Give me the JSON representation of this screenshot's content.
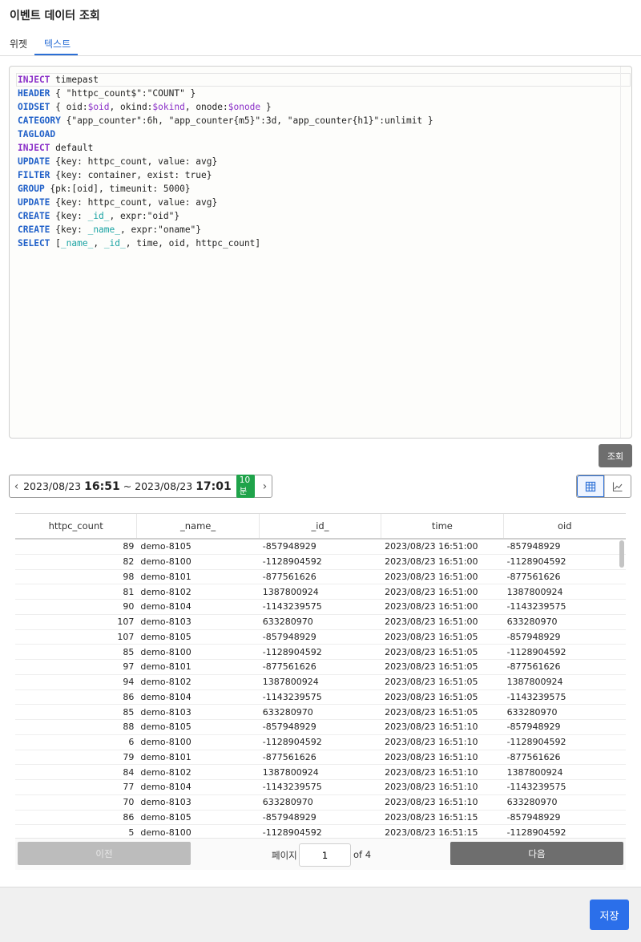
{
  "dialog": {
    "title": "이벤트 데이터 조회"
  },
  "tabs": [
    {
      "label": "위젯",
      "active": false
    },
    {
      "label": "텍스트",
      "active": true
    }
  ],
  "editor": {
    "lines": [
      [
        {
          "t": "INJECT",
          "c": "kw2"
        },
        {
          "t": " timepast"
        }
      ],
      [
        {
          "t": "HEADER",
          "c": "kw"
        },
        {
          "t": " { \"httpc_count$\":\"COUNT\" }"
        }
      ],
      [
        {
          "t": "OIDSET",
          "c": "kw"
        },
        {
          "t": " { oid:"
        },
        {
          "t": "$oid",
          "c": "var"
        },
        {
          "t": ", okind:"
        },
        {
          "t": "$okind",
          "c": "var"
        },
        {
          "t": ", onode:"
        },
        {
          "t": "$onode",
          "c": "var"
        },
        {
          "t": " }"
        }
      ],
      [
        {
          "t": "CATEGORY",
          "c": "kw"
        },
        {
          "t": " {\"app_counter\":6h, \"app_counter{m5}\":3d, \"app_counter{h1}\":unlimit }"
        }
      ],
      [
        {
          "t": "TAGLOAD",
          "c": "kw"
        }
      ],
      [
        {
          "t": "INJECT",
          "c": "kw2"
        },
        {
          "t": " default"
        }
      ],
      [
        {
          "t": "UPDATE",
          "c": "kw"
        },
        {
          "t": " {key: httpc_count, value: avg}"
        }
      ],
      [
        {
          "t": "FILTER",
          "c": "kw"
        },
        {
          "t": " {key: container, exist: true}"
        }
      ],
      [
        {
          "t": "GROUP",
          "c": "kw"
        },
        {
          "t": " {pk:[oid], timeunit: 5000}"
        }
      ],
      [
        {
          "t": "UPDATE",
          "c": "kw"
        },
        {
          "t": " {key: httpc_count, value: avg}"
        }
      ],
      [
        {
          "t": "CREATE",
          "c": "kw"
        },
        {
          "t": " {key: "
        },
        {
          "t": "_id_",
          "c": "cy"
        },
        {
          "t": ", expr:\"oid\"}"
        }
      ],
      [
        {
          "t": "CREATE",
          "c": "kw"
        },
        {
          "t": " {key: "
        },
        {
          "t": "_name_",
          "c": "cy"
        },
        {
          "t": ", expr:\"oname\"}"
        }
      ],
      [
        {
          "t": "SELECT",
          "c": "kw"
        },
        {
          "t": " ["
        },
        {
          "t": "_name_",
          "c": "cy"
        },
        {
          "t": ", "
        },
        {
          "t": "_id_",
          "c": "cy"
        },
        {
          "t": ", time, oid, httpc_count]"
        }
      ]
    ]
  },
  "query_button": "조회",
  "time_range": {
    "start_date": "2023/08/23",
    "start_time": "16:51",
    "separator": "~",
    "end_date": "2023/08/23",
    "end_time": "17:01",
    "duration": "10분"
  },
  "view_toggle": {
    "table_icon": "table-grid-icon",
    "chart_icon": "line-chart-icon",
    "active": "table"
  },
  "table": {
    "columns": [
      "httpc_count",
      "_name_",
      "_id_",
      "time",
      "oid"
    ],
    "rows": [
      [
        "89",
        "demo-8105",
        "-857948929",
        "2023/08/23 16:51:00",
        "-857948929"
      ],
      [
        "82",
        "demo-8100",
        "-1128904592",
        "2023/08/23 16:51:00",
        "-1128904592"
      ],
      [
        "98",
        "demo-8101",
        "-877561626",
        "2023/08/23 16:51:00",
        "-877561626"
      ],
      [
        "81",
        "demo-8102",
        "1387800924",
        "2023/08/23 16:51:00",
        "1387800924"
      ],
      [
        "90",
        "demo-8104",
        "-1143239575",
        "2023/08/23 16:51:00",
        "-1143239575"
      ],
      [
        "107",
        "demo-8103",
        "633280970",
        "2023/08/23 16:51:00",
        "633280970"
      ],
      [
        "107",
        "demo-8105",
        "-857948929",
        "2023/08/23 16:51:05",
        "-857948929"
      ],
      [
        "85",
        "demo-8100",
        "-1128904592",
        "2023/08/23 16:51:05",
        "-1128904592"
      ],
      [
        "97",
        "demo-8101",
        "-877561626",
        "2023/08/23 16:51:05",
        "-877561626"
      ],
      [
        "94",
        "demo-8102",
        "1387800924",
        "2023/08/23 16:51:05",
        "1387800924"
      ],
      [
        "86",
        "demo-8104",
        "-1143239575",
        "2023/08/23 16:51:05",
        "-1143239575"
      ],
      [
        "85",
        "demo-8103",
        "633280970",
        "2023/08/23 16:51:05",
        "633280970"
      ],
      [
        "88",
        "demo-8105",
        "-857948929",
        "2023/08/23 16:51:10",
        "-857948929"
      ],
      [
        "6",
        "demo-8100",
        "-1128904592",
        "2023/08/23 16:51:10",
        "-1128904592"
      ],
      [
        "79",
        "demo-8101",
        "-877561626",
        "2023/08/23 16:51:10",
        "-877561626"
      ],
      [
        "84",
        "demo-8102",
        "1387800924",
        "2023/08/23 16:51:10",
        "1387800924"
      ],
      [
        "77",
        "demo-8104",
        "-1143239575",
        "2023/08/23 16:51:10",
        "-1143239575"
      ],
      [
        "70",
        "demo-8103",
        "633280970",
        "2023/08/23 16:51:10",
        "633280970"
      ],
      [
        "86",
        "demo-8105",
        "-857948929",
        "2023/08/23 16:51:15",
        "-857948929"
      ],
      [
        "5",
        "demo-8100",
        "-1128904592",
        "2023/08/23 16:51:15",
        "-1128904592"
      ]
    ]
  },
  "pagination": {
    "prev_label": "이전",
    "page_label": "페이지",
    "page_value": "1",
    "of_label": "of 4",
    "next_label": "다음"
  },
  "footer": {
    "save_label": "저장"
  },
  "colors": {
    "accent": "#2b6fea",
    "badge_green": "#1fa34a",
    "keyword_blue": "#2060c8",
    "keyword_purple": "#8a2fc8",
    "field_cyan": "#1aa3a3"
  }
}
